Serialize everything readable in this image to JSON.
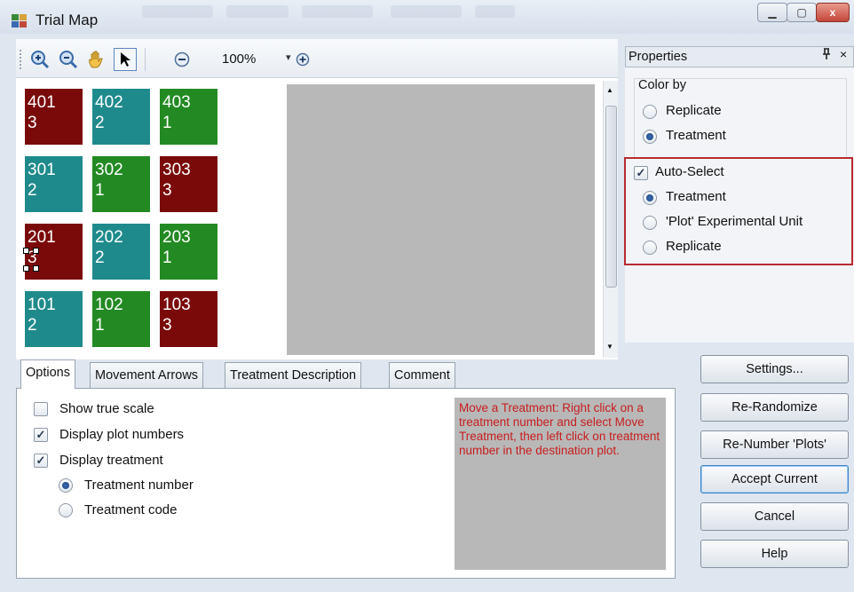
{
  "window": {
    "title": "Trial Map",
    "minimize_icon": "minimize-icon",
    "maximize_icon": "maximize-icon",
    "close_glyph": "x"
  },
  "toolbar": {
    "icons": [
      "zoom-in-icon",
      "zoom-out-icon",
      "pan-hand-icon",
      "select-arrow-icon",
      "zoom-minus-icon",
      "zoom-plus-icon"
    ],
    "zoom_level": "100%",
    "dropdown_glyph": "▾"
  },
  "plots": [
    {
      "plot": "401",
      "treatment": "3"
    },
    {
      "plot": "402",
      "treatment": "2"
    },
    {
      "plot": "403",
      "treatment": "1"
    },
    {
      "plot": "301",
      "treatment": "2"
    },
    {
      "plot": "302",
      "treatment": "1"
    },
    {
      "plot": "303",
      "treatment": "3"
    },
    {
      "plot": "201",
      "treatment": "3"
    },
    {
      "plot": "202",
      "treatment": "2"
    },
    {
      "plot": "203",
      "treatment": "1"
    },
    {
      "plot": "101",
      "treatment": "2"
    },
    {
      "plot": "102",
      "treatment": "1"
    },
    {
      "plot": "103",
      "treatment": "3"
    }
  ],
  "treatment_colors": {
    "1": "#238a23",
    "2": "#1f8a8c",
    "3": "#7a0a0a"
  },
  "tabs": [
    "Options",
    "Movement Arrows",
    "Treatment Description",
    "Comment"
  ],
  "options": {
    "show_true_scale": {
      "label": "Show true scale",
      "checked": false
    },
    "display_plot_numbers": {
      "label": "Display plot numbers",
      "checked": true
    },
    "display_treatment": {
      "label": "Display treatment",
      "checked": true
    },
    "treatment_number": {
      "label": "Treatment number",
      "selected": true
    },
    "treatment_code": {
      "label": "Treatment code",
      "selected": false
    }
  },
  "help_text": "Move a Treatment:  Right click on a treatment number and select Move Treatment, then left click on treatment number in the destination plot.",
  "properties": {
    "header": "Properties",
    "pin_glyph": "ꟷ",
    "close_glyph": "×",
    "color_by": {
      "label": "Color by",
      "options": [
        {
          "label": "Replicate",
          "selected": false
        },
        {
          "label": "Treatment",
          "selected": true
        }
      ]
    },
    "auto_select": {
      "label": "Auto-Select",
      "checked": true,
      "options": [
        {
          "label": "Treatment",
          "selected": true
        },
        {
          "label": "'Plot' Experimental Unit",
          "selected": false
        },
        {
          "label": "Replicate",
          "selected": false
        }
      ]
    }
  },
  "buttons": {
    "settings": "Settings...",
    "re_randomize": "Re-Randomize",
    "re_number": "Re-Number 'Plots'",
    "accept_current": "Accept Current",
    "cancel": "Cancel",
    "help": "Help"
  },
  "checkmark": "✓",
  "highlight_color": "#b82a30"
}
